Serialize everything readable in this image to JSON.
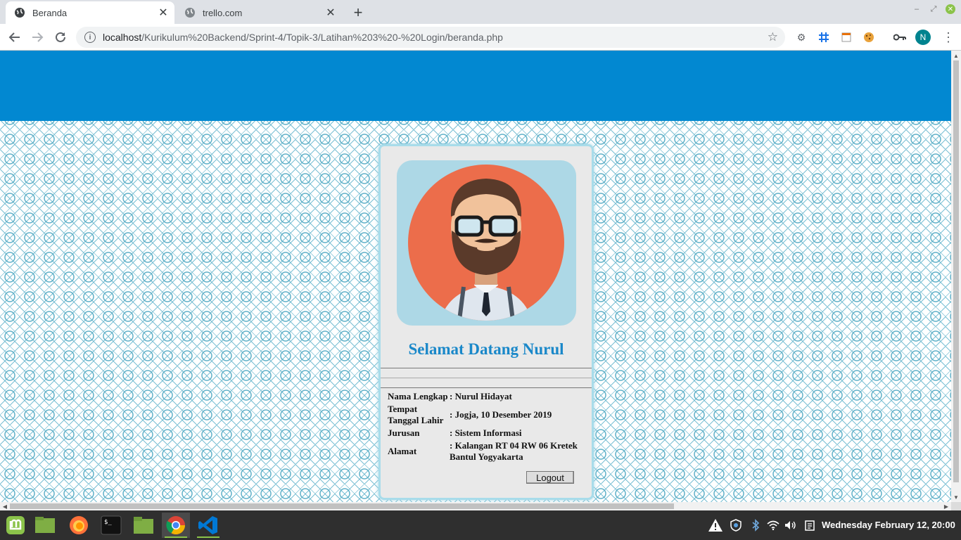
{
  "browser": {
    "tabs": [
      {
        "title": "Beranda",
        "active": true
      },
      {
        "title": "trello.com",
        "active": false
      }
    ],
    "url_host": "localhost",
    "url_path": "/Kurikulum%20Backend/Sprint-4/Topik-3/Latihan%203%20-%20Login/beranda.php",
    "profile_initial": "N",
    "icons": [
      "back-icon",
      "forward-icon",
      "reload-icon",
      "info-icon",
      "star-icon",
      "settings-extension-icon",
      "grid-extension-icon",
      "calendar-extension-icon",
      "cookie-extension-icon",
      "key-icon",
      "more-menu-icon"
    ]
  },
  "page": {
    "header_color": "#0288d1",
    "welcome": "Selamat Datang Nurul",
    "profile": [
      {
        "label": "Nama Lengkap",
        "value": ": Nurul Hidayat"
      },
      {
        "label": "Tempat Tanggal Lahir",
        "value": ": Jogja, 10 Desember 2019"
      },
      {
        "label": "Jurusan",
        "value": ": Sistem Informasi"
      },
      {
        "label": "Alamat",
        "value": ": Kalangan RT 04 RW 06 Kretek Bantul Yogyakarta"
      }
    ],
    "logout_label": "Logout"
  },
  "taskbar": {
    "apps": [
      "mint-menu-icon",
      "show-desktop-icon",
      "firefox-icon",
      "terminal-icon",
      "files-icon",
      "chrome-icon",
      "vscode-icon"
    ],
    "tray": [
      "warning-icon",
      "shield-icon",
      "bluetooth-icon",
      "wifi-icon",
      "volume-icon",
      "clipboard-icon"
    ],
    "clock": "Wednesday February 12, 20:00"
  }
}
